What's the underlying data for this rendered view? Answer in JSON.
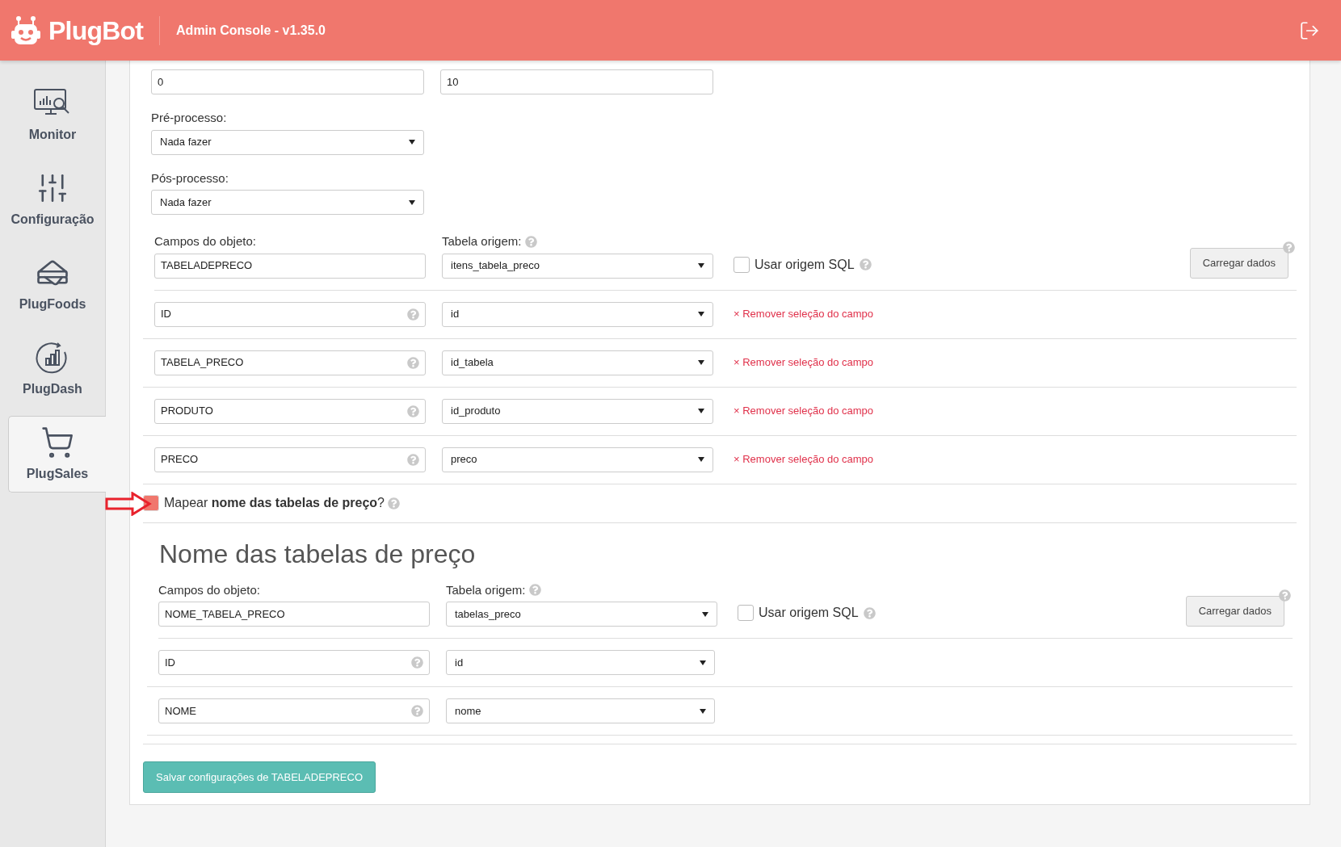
{
  "header": {
    "logo_text": "PlugBot",
    "subtitle": "Admin Console - v1.35.0"
  },
  "sidebar": {
    "items": [
      {
        "kind": "monitor",
        "label": "Monitor",
        "selected": false
      },
      {
        "kind": "config",
        "label": "Configuração",
        "selected": false
      },
      {
        "kind": "foods",
        "label": "PlugFoods",
        "selected": false
      },
      {
        "kind": "dash",
        "label": "PlugDash",
        "selected": false
      },
      {
        "kind": "sales",
        "label": "PlugSales",
        "selected": true
      }
    ]
  },
  "schedule": [
    {
      "value": "0"
    },
    {
      "value": "10"
    }
  ],
  "process_fields": [
    {
      "label": "Pré-processo:",
      "value": "Nada fazer"
    },
    {
      "label": "Pós-processo:",
      "value": "Nada fazer"
    }
  ],
  "main_mapping": {
    "object_label": "Campos do objeto:",
    "object_value": "TABELADEPRECO",
    "source_label": "Tabela origem:",
    "source_value": "itens_tabela_preco",
    "sql_label": "Usar origem SQL",
    "sql_checked": false,
    "load_button": "Carregar dados",
    "rows": [
      {
        "field": "ID",
        "column": "id",
        "remove_mark": "×",
        "remove_label": "Remover seleção do campo"
      },
      {
        "field": "TABELA_PRECO",
        "column": "id_tabela",
        "remove_mark": "×",
        "remove_label": "Remover seleção do campo"
      },
      {
        "field": "PRODUTO",
        "column": "id_produto",
        "remove_mark": "×",
        "remove_label": "Remover seleção do campo"
      },
      {
        "field": "PRECO",
        "column": "preco",
        "remove_mark": "×",
        "remove_label": "Remover seleção do campo"
      }
    ]
  },
  "map_names": {
    "checked": true,
    "text": "Mapear **nome das tabelas de preço**?"
  },
  "names_section": {
    "title": "Nome das tabelas de preço",
    "object_label": "Campos do objeto:",
    "object_value": "NOME_TABELA_PRECO",
    "source_label": "Tabela origem:",
    "source_value": "tabelas_preco",
    "sql_label": "Usar origem SQL",
    "sql_checked": false,
    "load_button": "Carregar dados",
    "rows": [
      {
        "field": "ID",
        "column": "id"
      },
      {
        "field": "NOME",
        "column": "nome"
      }
    ]
  },
  "save_button": "Salvar configurações de TABELADEPRECO"
}
